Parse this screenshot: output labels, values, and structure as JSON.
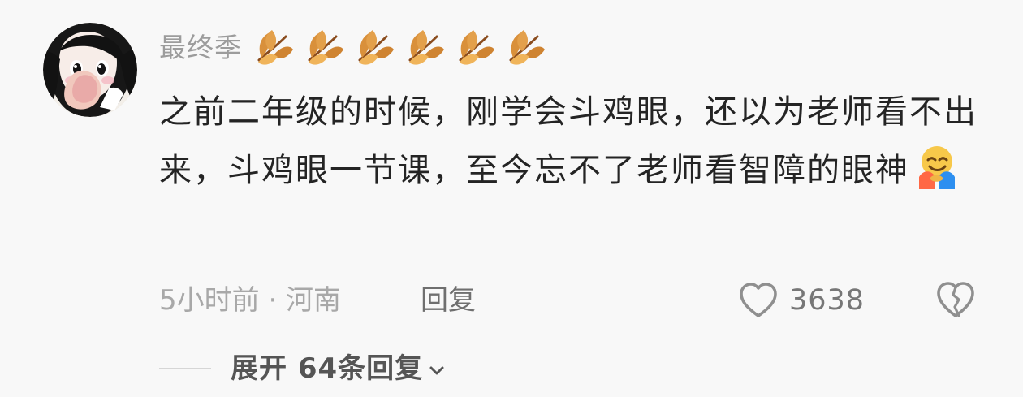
{
  "comment": {
    "author": "最终季",
    "badges": [
      {
        "icon": "leaf-icon"
      },
      {
        "icon": "leaf-icon"
      },
      {
        "icon": "leaf-icon"
      },
      {
        "icon": "leaf-icon"
      },
      {
        "icon": "leaf-icon"
      },
      {
        "icon": "leaf-icon"
      }
    ],
    "body": "之前二年级的时候，刚学会斗鸡眼，还以为老师看不出来，斗鸡眼一节课，至今忘不了老师看智障的眼神",
    "emoji": "hugging-face-emoji",
    "time_location": "5小时前 · 河南",
    "reply_label": "回复",
    "like_count": "3638",
    "expand_replies_label": "展开 64条回复"
  },
  "colors": {
    "background": "#f8f8f8",
    "text_primary": "#242424",
    "text_secondary": "#a8a8a8",
    "text_muted": "#777777",
    "leaf_orange": "#d9903b",
    "leaf_dark": "#8a4c1e"
  }
}
